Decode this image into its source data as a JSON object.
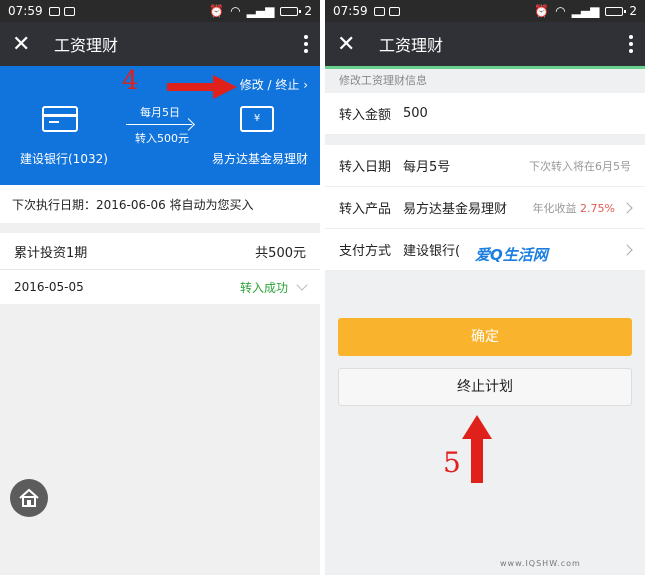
{
  "left": {
    "status": {
      "time": "07:59",
      "battery": "2"
    },
    "topbar": {
      "title": "工资理财"
    },
    "panel": {
      "modify_link": "修改 / 终止",
      "annotation": "4",
      "bank": "建设银行(1032)",
      "schedule": "每月5日",
      "amount": "转入500元",
      "fund_icon": "¥",
      "fund": "易方达基金易理财"
    },
    "next_exec": "下次执行日期：2016-06-06 将自动为您买入",
    "summary": {
      "label": "累计投资1期",
      "total": "共500元"
    },
    "record": {
      "date": "2016-05-05",
      "status": "转入成功"
    }
  },
  "right": {
    "status": {
      "time": "07:59",
      "battery": "2"
    },
    "topbar": {
      "title": "工资理财"
    },
    "section_title": "修改工资理财信息",
    "amount_row": {
      "label": "转入金额",
      "value": "500"
    },
    "date_row": {
      "label": "转入日期",
      "value": "每月5号",
      "note": "下次转入将在6月5号"
    },
    "product_row": {
      "label": "转入产品",
      "value": "易方达基金易理财",
      "note_label": "年化收益",
      "note_value": "2.75%"
    },
    "pay_row": {
      "label": "支付方式",
      "value": "建设银行("
    },
    "confirm_label": "确定",
    "stop_label": "终止计划",
    "annotation": "5",
    "watermark": "爱Q生活网",
    "watermark_url": "www.IQSHW.com"
  },
  "colors": {
    "blue_panel": "#1173dc",
    "confirm": "#fab32d",
    "success": "#2fa33a",
    "annotation": "#e0201a"
  }
}
